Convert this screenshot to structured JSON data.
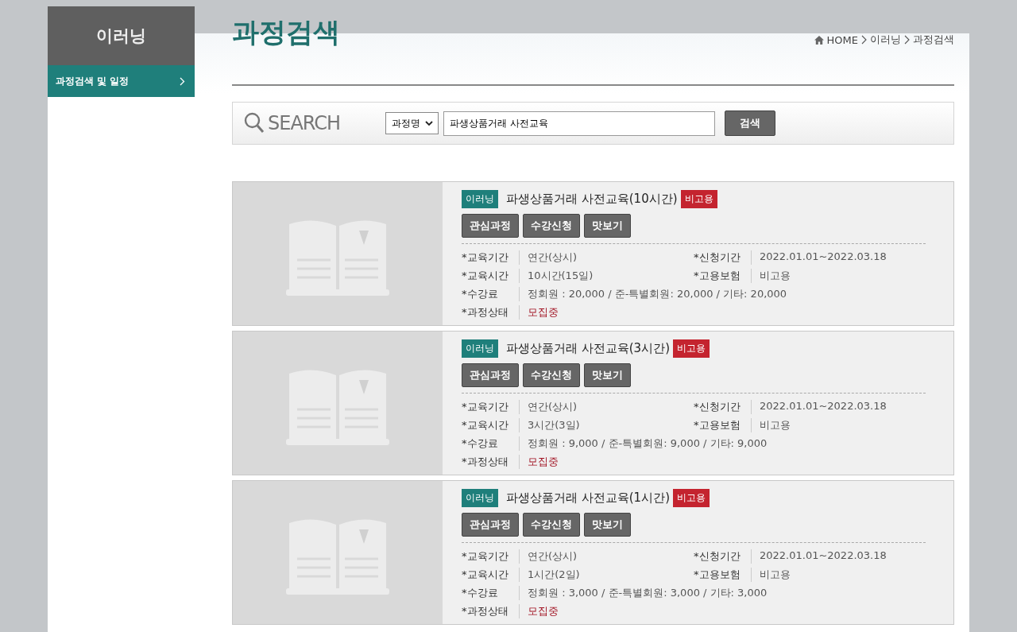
{
  "sidebar": {
    "title": "이러닝",
    "items": [
      {
        "label": "과정검색 및 일정",
        "selected": true
      }
    ]
  },
  "page_title": "과정검색",
  "breadcrumb": [
    "HOME",
    "이러닝",
    "과정검색"
  ],
  "search": {
    "label": "SEARCH",
    "select": "과정명",
    "value": "파생상품거래 사전교육",
    "button": "검색"
  },
  "courses": [
    {
      "category": "이러닝",
      "title": "파생상품거래 사전교육(10시간)",
      "badge": "비고용",
      "buttons": [
        "관심과정",
        "수강신청",
        "맛보기"
      ],
      "fields": [
        {
          "kind": "pair",
          "label": "*교육기간",
          "value": "연간(상시)"
        },
        {
          "kind": "pair",
          "label": "*신청기간",
          "value": "2022.01.01~2022.03.18"
        },
        {
          "kind": "pair",
          "label": "*교육시간",
          "value": "10시간(15일)"
        },
        {
          "kind": "pair",
          "label": "*고용보험",
          "value": "비고용"
        },
        {
          "kind": "wide",
          "label": "*수강료",
          "value": "정회원 : 20,000 / 준-특별회원: 20,000 / 기타: 20,000"
        },
        {
          "kind": "status",
          "label": "*과정상태",
          "value": "모집중"
        }
      ]
    },
    {
      "category": "이러닝",
      "title": "파생상품거래 사전교육(3시간)",
      "badge": "비고용",
      "buttons": [
        "관심과정",
        "수강신청",
        "맛보기"
      ],
      "fields": [
        {
          "kind": "pair",
          "label": "*교육기간",
          "value": "연간(상시)"
        },
        {
          "kind": "pair",
          "label": "*신청기간",
          "value": "2022.01.01~2022.03.18"
        },
        {
          "kind": "pair",
          "label": "*교육시간",
          "value": "3시간(3일)"
        },
        {
          "kind": "pair",
          "label": "*고용보험",
          "value": "비고용"
        },
        {
          "kind": "wide",
          "label": "*수강료",
          "value": "정회원 : 9,000 / 준-특별회원: 9,000 / 기타: 9,000"
        },
        {
          "kind": "status",
          "label": "*과정상태",
          "value": "모집중"
        }
      ]
    },
    {
      "category": "이러닝",
      "title": "파생상품거래 사전교육(1시간)",
      "badge": "비고용",
      "buttons": [
        "관심과정",
        "수강신청",
        "맛보기"
      ],
      "fields": [
        {
          "kind": "pair",
          "label": "*교육기간",
          "value": "연간(상시)"
        },
        {
          "kind": "pair",
          "label": "*신청기간",
          "value": "2022.01.01~2022.03.18"
        },
        {
          "kind": "pair",
          "label": "*교육시간",
          "value": "1시간(2일)"
        },
        {
          "kind": "pair",
          "label": "*고용보험",
          "value": "비고용"
        },
        {
          "kind": "wide",
          "label": "*수강료",
          "value": "정회원 : 3,000 / 준-특별회원: 3,000 / 기타: 3,000"
        },
        {
          "kind": "status",
          "label": "*과정상태",
          "value": "모집중"
        }
      ]
    }
  ]
}
